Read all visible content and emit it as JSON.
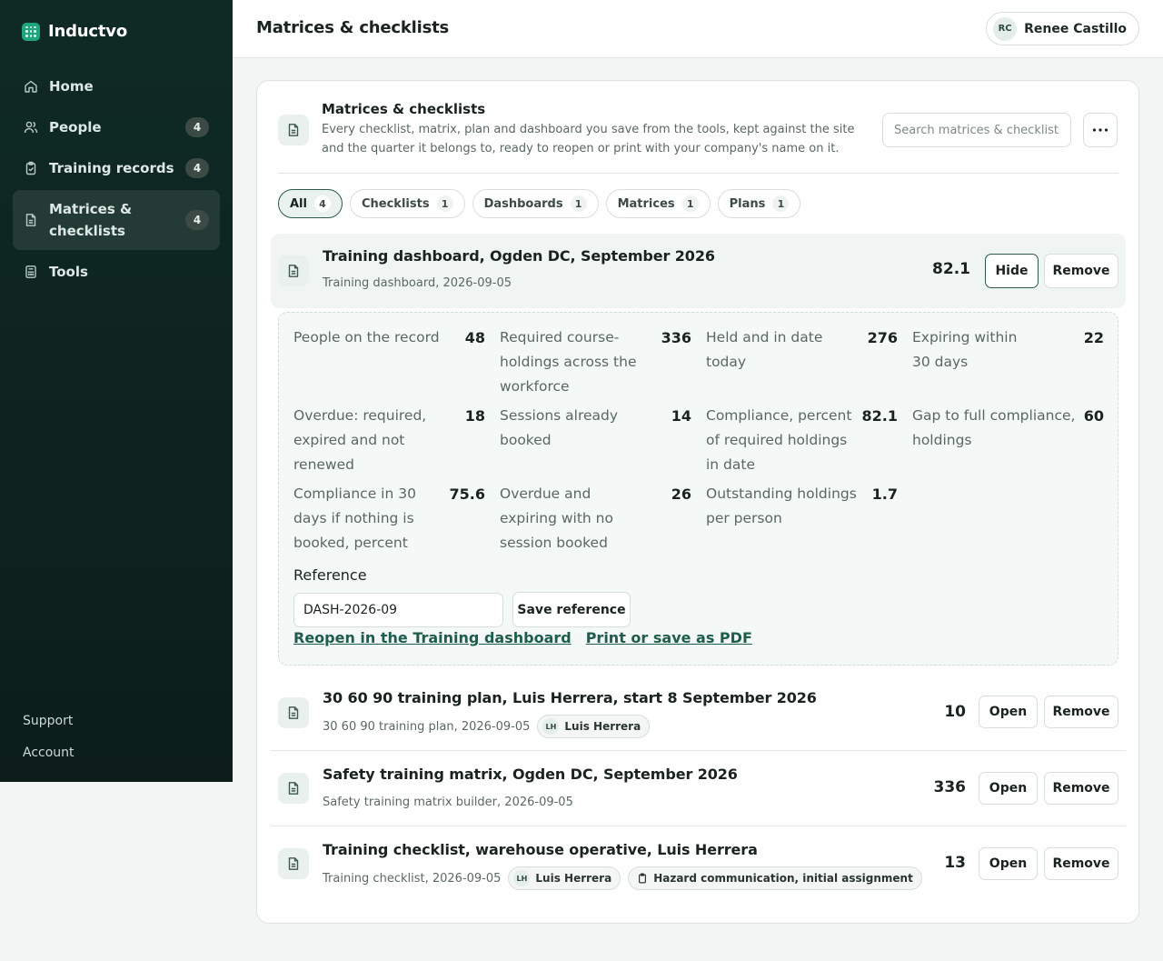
{
  "app": {
    "name": "Inductvo"
  },
  "sidebar": {
    "items": [
      {
        "label": "Home",
        "count": null
      },
      {
        "label": "People",
        "count": "4"
      },
      {
        "label": "Training records",
        "count": "4"
      },
      {
        "label": "Matrices & checklists",
        "count": "4"
      },
      {
        "label": "Tools",
        "count": null
      }
    ],
    "bottom": {
      "support": "Support",
      "account": "Account"
    }
  },
  "header": {
    "title": "Matrices & checklists",
    "user": {
      "initials": "RC",
      "name": "Renee Castillo"
    }
  },
  "card": {
    "title": "Matrices & checklists",
    "description": "Every checklist, matrix, plan and dashboard you save from the tools, kept against the site and the quarter it belongs to, ready to reopen or print with your company's name on it.",
    "search_placeholder": "Search matrices & checklists"
  },
  "filters": [
    {
      "label": "All",
      "count": "4"
    },
    {
      "label": "Checklists",
      "count": "1"
    },
    {
      "label": "Dashboards",
      "count": "1"
    },
    {
      "label": "Matrices",
      "count": "1"
    },
    {
      "label": "Plans",
      "count": "1"
    }
  ],
  "items": [
    {
      "title": "Training dashboard, Ogden DC, September 2026",
      "meta": "Training dashboard, 2026-09-05",
      "value": "82.1",
      "primary_action": "Hide",
      "remove": "Remove",
      "details": {
        "metrics": [
          {
            "label": "People on the record",
            "value": "48"
          },
          {
            "label": "Required course-holdings across the workforce",
            "value": "336"
          },
          {
            "label": "Held and in date today",
            "value": "276"
          },
          {
            "label": "Expiring within 30 days",
            "value": "22"
          },
          {
            "label": "Overdue: required, expired and not renewed",
            "value": "18"
          },
          {
            "label": "Sessions already booked",
            "value": "14"
          },
          {
            "label": "Compliance, percent of required holdings in date",
            "value": "82.1"
          },
          {
            "label": "Gap to full compliance, holdings",
            "value": "60"
          },
          {
            "label": "Compliance in 30 days if nothing is booked, percent",
            "value": "75.6"
          },
          {
            "label": "Overdue and expiring with no session booked",
            "value": "26"
          },
          {
            "label": "Outstanding holdings per person",
            "value": "1.7"
          }
        ],
        "reference_label": "Reference",
        "reference_value": "DASH-2026-09",
        "save_reference": "Save reference",
        "reopen_link": "Reopen in the Training dashboard",
        "print_link": "Print or save as PDF"
      }
    },
    {
      "title": "30 60 90 training plan, Luis Herrera, start 8 September 2026",
      "meta": "30 60 90 training plan, 2026-09-05",
      "tag_person": {
        "initials": "LH",
        "name": "Luis Herrera"
      },
      "value": "10",
      "primary_action": "Open",
      "remove": "Remove"
    },
    {
      "title": "Safety training matrix, Ogden DC, September 2026",
      "meta": "Safety training matrix builder, 2026-09-05",
      "value": "336",
      "primary_action": "Open",
      "remove": "Remove"
    },
    {
      "title": "Training checklist, warehouse operative, Luis Herrera",
      "meta": "Training checklist, 2026-09-05",
      "tag_person": {
        "initials": "LH",
        "name": "Luis Herrera"
      },
      "tag_course": "Hazard communication, initial assignment",
      "value": "13",
      "primary_action": "Open",
      "remove": "Remove"
    }
  ]
}
